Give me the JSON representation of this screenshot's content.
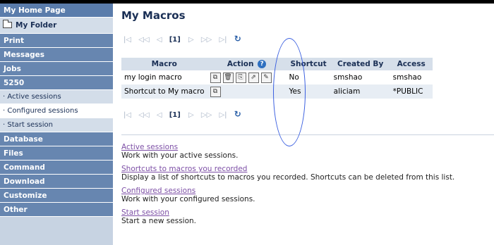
{
  "sidebar": {
    "home": "My Home Page",
    "folder": "My Folder",
    "items": [
      {
        "label": "Print",
        "type": "main"
      },
      {
        "label": "Messages",
        "type": "main"
      },
      {
        "label": "Jobs",
        "type": "main"
      },
      {
        "label": "5250",
        "type": "main"
      },
      {
        "label": "· Active sessions",
        "type": "sub"
      },
      {
        "label": "· Configured sessions",
        "type": "sub-active"
      },
      {
        "label": "· Start session",
        "type": "sub"
      },
      {
        "label": "Database",
        "type": "main"
      },
      {
        "label": "Files",
        "type": "main"
      },
      {
        "label": "Command",
        "type": "main"
      },
      {
        "label": "Download",
        "type": "main"
      },
      {
        "label": "Customize",
        "type": "main"
      },
      {
        "label": "Other",
        "type": "main"
      }
    ]
  },
  "main": {
    "title": "My Macros",
    "pager": {
      "first": "|◁",
      "prev_page": "◁◁",
      "prev": "◁",
      "page": "[1]",
      "next": "▷",
      "next_page": "▷▷",
      "last": "▷|",
      "refresh": "↻"
    },
    "table": {
      "headers": [
        "Macro",
        "Action",
        "Shortcut",
        "Created By",
        "Access"
      ],
      "help": "?",
      "rows": [
        {
          "macro": "my login macro",
          "shortcut": "No",
          "created_by": "smshao",
          "access": "smshao"
        },
        {
          "macro": "Shortcut to My macro",
          "shortcut": "Yes",
          "created_by": "aliciam",
          "access": "*PUBLIC"
        }
      ]
    },
    "links": [
      {
        "title": "Active sessions",
        "desc": "Work with your active sessions."
      },
      {
        "title": "Shortcuts to macros you recorded",
        "desc": "Display a list of shortcuts to macros you recorded. Shortcuts can be deleted from this list."
      },
      {
        "title": "Configured sessions",
        "desc": "Work with your configured sessions."
      },
      {
        "title": "Start session",
        "desc": "Start a new session."
      }
    ]
  },
  "colors": {
    "sidebar_main": "#6786b0",
    "sidebar_sub": "#d3dde9",
    "title": "#1a2f55",
    "visited_link": "#7d4fa6",
    "annotation": "#3a5fe0"
  },
  "icons": {
    "action_copy": "copy-icon",
    "action_delete": "delete-icon",
    "action_shortcut": "shortcut-icon",
    "action_run": "run-icon",
    "action_edit": "edit-icon",
    "refresh": "refresh-icon",
    "folder": "folder-icon",
    "help": "help-icon"
  }
}
